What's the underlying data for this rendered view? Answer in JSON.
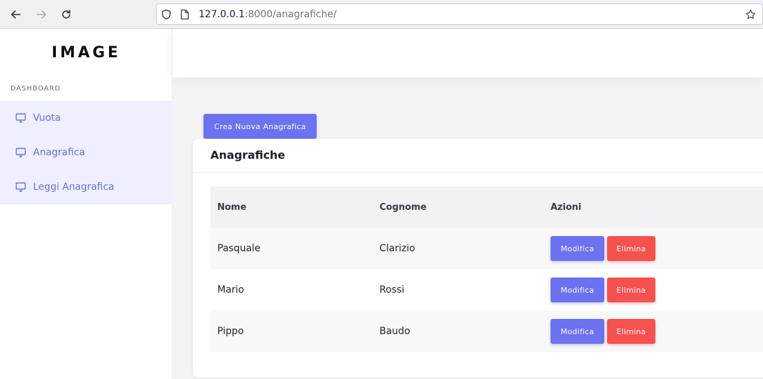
{
  "browser": {
    "url_host": "127.0.0.1",
    "url_rest": ":8000/anagrafiche/",
    "icons": [
      "back-arrow-icon",
      "forward-arrow-icon",
      "reload-icon",
      "shield-icon",
      "page-icon",
      "star-icon"
    ]
  },
  "sidebar": {
    "logo": "IMAGE",
    "section_label": "DASHBOARD",
    "items": [
      {
        "label": "Vuota",
        "icon": "monitor-icon"
      },
      {
        "label": "Anagrafica",
        "icon": "monitor-icon"
      },
      {
        "label": "Leggi Anagrafica",
        "icon": "monitor-icon"
      }
    ]
  },
  "main": {
    "create_button": "Crea Nuova Anagrafica",
    "card_title": "Anagrafiche",
    "table": {
      "headers": [
        "Nome",
        "Cognome",
        "Azioni"
      ],
      "rows": [
        {
          "nome": "Pasquale",
          "cognome": "Clarizio"
        },
        {
          "nome": "Mario",
          "cognome": "Rossi"
        },
        {
          "nome": "Pippo",
          "cognome": "Baudo"
        }
      ],
      "edit_label": "Modifica",
      "delete_label": "Elimina"
    }
  },
  "colors": {
    "accent": "#6c72f0",
    "danger": "#f5514f",
    "sidebar_active_bg": "#eef0ff"
  }
}
